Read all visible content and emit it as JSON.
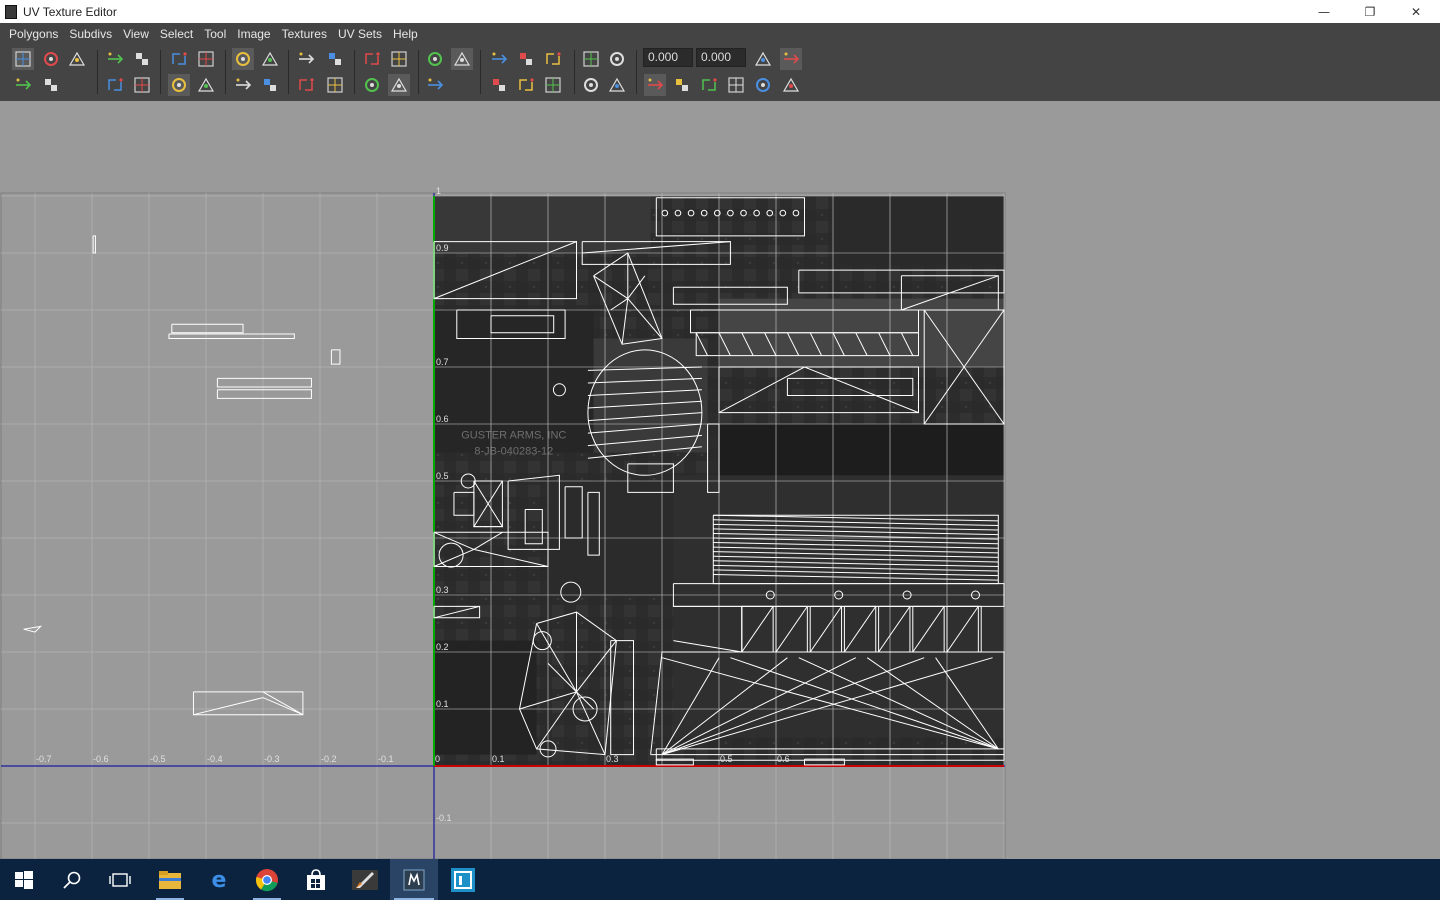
{
  "window": {
    "title": "UV Texture Editor",
    "controls": {
      "minimize": "—",
      "restore": "❐",
      "close": "✕"
    }
  },
  "menu": [
    "Polygons",
    "Subdivs",
    "View",
    "Select",
    "Tool",
    "Image",
    "Textures",
    "UV Sets",
    "Help"
  ],
  "toolbar": {
    "u_value": "0.000",
    "v_value": "0.000",
    "icons_row1": [
      "grid-snap-icon",
      "select-uv-shell-icon",
      "select-face-icon",
      "flip-u-icon",
      "flip-v-icon",
      "rotate-ccw-icon",
      "rotate-cw-icon",
      "cut-uv-icon",
      "sew-uv-icon",
      "move-sew-icon",
      "merge-uv-icon",
      "layout-icon",
      "unfold-icon",
      "relax-icon",
      "align-u-icon",
      "align-v-icon",
      "image-display-icon",
      "checker-icon",
      "grid-toggle-icon",
      "snapshot-icon",
      "shaded-uv-icon",
      "pixel-snap-icon",
      "refresh-icon",
      "copy-uv-icon",
      "paste-uv-icon"
    ],
    "icons_row2": [
      "normalize-icon",
      "unitize-icon",
      "straighten-icon",
      "smudge-icon",
      "scale-icon",
      "pin-icon",
      "move-shell-icon",
      "cycle-icon",
      "isolate-icon",
      "shaded-icon",
      "rgb-channel-icon",
      "alpha-channel-icon",
      "dim-image-icon",
      "copy-icon",
      "paste-icon",
      "paste-u-icon",
      "paste-v-icon",
      "swap-icon",
      "delete-icon"
    ]
  },
  "viewport": {
    "v_labels": [
      "1",
      "0.9",
      "0.7",
      "0.6",
      "0.5",
      "0.3",
      "0.2",
      "0.1",
      "-0.1"
    ],
    "u_labels": [
      "-0.7",
      "-0.6",
      "-0.5",
      "-0.4",
      "-0.3",
      "-0.2",
      "-0.1",
      "0",
      "0.1",
      "0.3",
      "0.5",
      "0.6"
    ],
    "texture_text_line1": "GUSTER ARMS, INC",
    "texture_text_line2": "8-JB-040283-12"
  },
  "taskbar": {
    "apps": [
      "start-icon",
      "search-icon",
      "task-view-icon",
      "file-explorer-icon",
      "edge-icon",
      "chrome-icon",
      "store-icon",
      "rocket-app-icon",
      "maya-app-icon",
      "launcher-app-icon"
    ]
  },
  "colors": {
    "background": "#9a9a9a",
    "chrome": "#444444",
    "taskbar": "#0c2340",
    "grid_line": "#b8b8b8",
    "wire": "#ffffff",
    "u_axis": "#cc0000",
    "v_axis": "#00aa00",
    "uv_boundary": "#1a1aa0"
  }
}
